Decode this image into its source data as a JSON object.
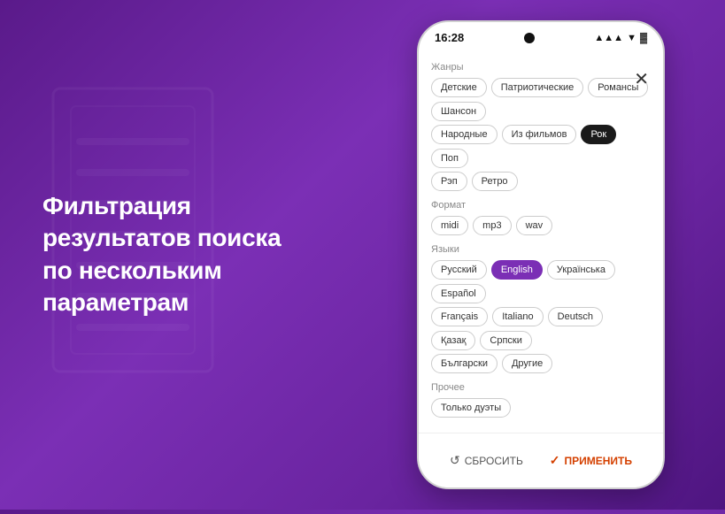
{
  "background": {
    "color_start": "#5a1a8a",
    "color_end": "#4e1580"
  },
  "left_text": {
    "line1": "Фильтрация",
    "line2": "результатов поиска",
    "line3": "по нескольким",
    "line4": "параметрам"
  },
  "phone": {
    "status_bar": {
      "time": "16:28",
      "signal": "▲",
      "wifi": "▲",
      "battery": "▓"
    },
    "close_label": "✕",
    "sections": [
      {
        "id": "genres",
        "title": "Жанры",
        "rows": [
          [
            "Детские",
            "Патриотические",
            "Романсы",
            "Шансон"
          ],
          [
            "Народные",
            "Из фильмов",
            "Рок",
            "Поп"
          ],
          [
            "Рэп",
            "Ретро"
          ]
        ],
        "active": [
          "Рок"
        ]
      },
      {
        "id": "format",
        "title": "Формат",
        "rows": [
          [
            "midi",
            "mp3",
            "wav"
          ]
        ],
        "active": []
      },
      {
        "id": "languages",
        "title": "Языки",
        "rows": [
          [
            "Русский",
            "English",
            "Українська",
            "Español"
          ],
          [
            "Français",
            "Italiano",
            "Deutsch",
            "Қазақ",
            "Српски"
          ],
          [
            "Български",
            "Другие"
          ]
        ],
        "active": [
          "English"
        ]
      },
      {
        "id": "other",
        "title": "Прочее",
        "rows": [
          [
            "Только дуэты"
          ]
        ],
        "active": []
      }
    ],
    "bottom": {
      "reset_label": "СБРОСИТЬ",
      "apply_label": "ПРИМЕНИТЬ"
    }
  }
}
